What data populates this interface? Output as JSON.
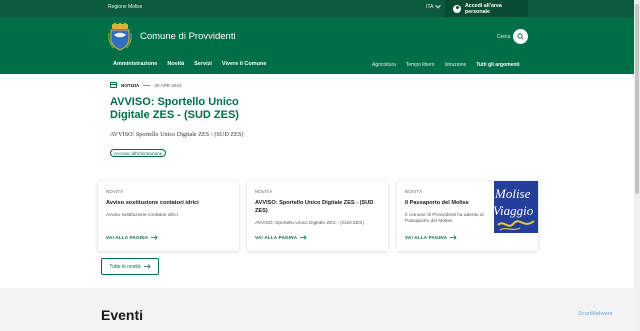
{
  "topbar": {
    "region": "Regione Molise",
    "language": "ITA",
    "login_label": "Accedi all'area personale"
  },
  "header": {
    "site_title": "Comune di Provvidenti",
    "search_label": "Cerca",
    "main_nav": [
      "Amministrazione",
      "Novità",
      "Servizi",
      "Vivere il Comune"
    ],
    "secondary_nav": [
      "Agricoltura",
      "Tempo libero",
      "Istruzione",
      "Tutti gli argomenti"
    ]
  },
  "hero": {
    "type": "NOTIZIA",
    "date": "20 APR 2024",
    "title": "AVVISO: Sportello Unico Digitale ZES - (SUD ZES)",
    "lead": "AVVISO: Sportello Unico Digitale ZES - (SUD ZES)",
    "topic": "Accesso all'informazione"
  },
  "cards": [
    {
      "tag": "NOVITÀ",
      "title": "Avviso sostituzione contatori idrici",
      "description": "Avviso sostituzione contatori idrici",
      "cta": "VAI ALLA PAGINA"
    },
    {
      "tag": "NOVITÀ",
      "title": "AVVISO: Sportello Unico Digitale ZES - (SUD ZES)",
      "description": "AVVISO: Sportello Unico Digitale ZES - (SUD ZES)",
      "cta": "VAI ALLA PAGINA"
    },
    {
      "tag": "NOVITÀ",
      "title": "Il Passaporto del Molise",
      "description": "Il comune di Provvidenti ha aderito al Passaporto del Molise",
      "cta": "VAI ALLA PAGINA",
      "thumbnail_text": "Molise Viaggio"
    }
  ],
  "all_news_label": "Tutte le novità",
  "events_heading": "Eventi",
  "watermark": "ScanMalware",
  "colors": {
    "brand_green": "#006e47",
    "dark_green": "#0b5a3d",
    "events_bg": "#f3f3f3"
  }
}
